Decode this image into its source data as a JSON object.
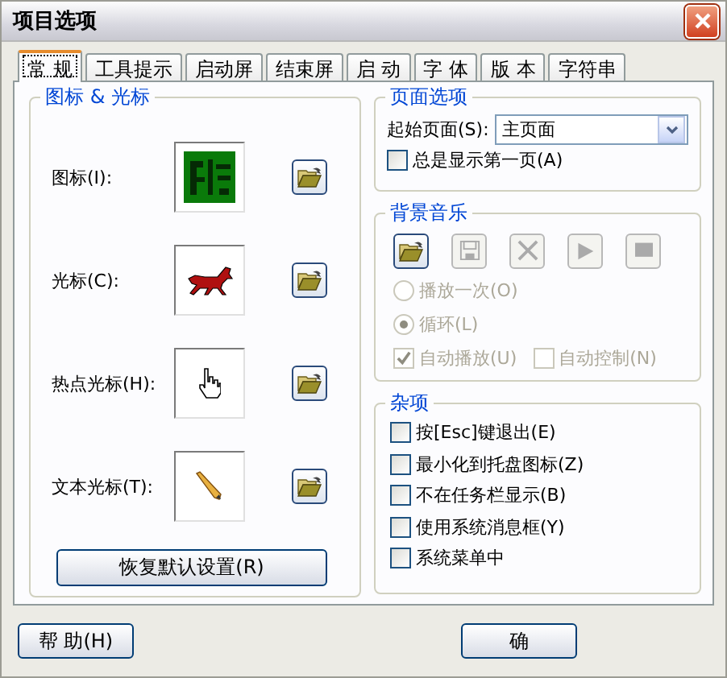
{
  "window": {
    "title": "项目选项"
  },
  "tabs": [
    {
      "label": "常 规",
      "selected": true
    },
    {
      "label": "工具提示",
      "selected": false
    },
    {
      "label": "启动屏",
      "selected": false
    },
    {
      "label": "结束屏",
      "selected": false
    },
    {
      "label": "启 动",
      "selected": false
    },
    {
      "label": "字 体",
      "selected": false
    },
    {
      "label": "版 本",
      "selected": false
    },
    {
      "label": "字符串",
      "selected": false
    }
  ],
  "icon_group": {
    "title": "图标 & 光标",
    "rows": [
      {
        "label": "图标(I):",
        "kind": "app"
      },
      {
        "label": "光标(C):",
        "kind": "horse"
      },
      {
        "label": "热点光标(H):",
        "kind": "hand"
      },
      {
        "label": "文本光标(T):",
        "kind": "pencil"
      }
    ],
    "reset_button": "恢复默认设置(R)"
  },
  "page_options": {
    "title": "页面选项",
    "start_page_label": "起始页面(S):",
    "start_page_value": "主页面",
    "always_first": {
      "label": "总是显示第一页(A)",
      "checked": false
    }
  },
  "music": {
    "title": "背景音乐",
    "toolbar": [
      {
        "kind": "open",
        "disabled": false
      },
      {
        "kind": "save",
        "disabled": true
      },
      {
        "kind": "delete",
        "disabled": true
      },
      {
        "kind": "play",
        "disabled": true
      },
      {
        "kind": "stop",
        "disabled": true
      }
    ],
    "radios": [
      {
        "label": "播放一次(O)",
        "selected": false,
        "disabled": true
      },
      {
        "label": "循环(L)",
        "selected": true,
        "disabled": true
      }
    ],
    "checks": [
      {
        "label": "自动播放(U)",
        "checked": true,
        "disabled": true
      },
      {
        "label": "自动控制(N)",
        "checked": false,
        "disabled": true
      }
    ]
  },
  "misc": {
    "title": "杂项",
    "options": [
      {
        "label": "按[Esc]键退出(E)",
        "checked": false
      },
      {
        "label": "最小化到托盘图标(Z)",
        "checked": false
      },
      {
        "label": "不在任务栏显示(B)",
        "checked": false
      },
      {
        "label": "使用系统消息框(Y)",
        "checked": false
      },
      {
        "label": "系统菜单中",
        "checked": false
      }
    ]
  },
  "buttons": [
    {
      "label": "帮 助(H)"
    },
    {
      "label": "确"
    }
  ]
}
